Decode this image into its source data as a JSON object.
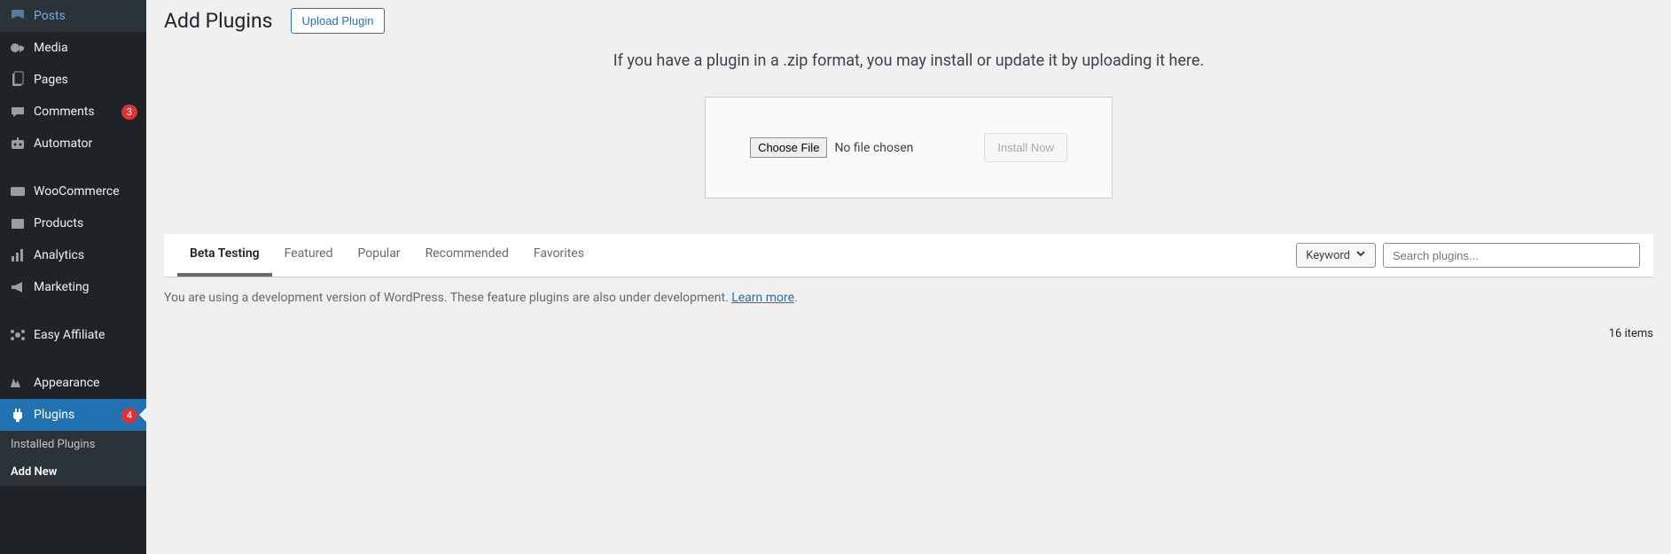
{
  "sidebar": {
    "items": [
      {
        "label": "Posts",
        "icon": "posts"
      },
      {
        "label": "Media",
        "icon": "media"
      },
      {
        "label": "Pages",
        "icon": "pages"
      },
      {
        "label": "Comments",
        "icon": "comments",
        "badge": "3"
      },
      {
        "label": "Automator",
        "icon": "automator"
      },
      {
        "label": "WooCommerce",
        "icon": "woo"
      },
      {
        "label": "Products",
        "icon": "products"
      },
      {
        "label": "Analytics",
        "icon": "analytics"
      },
      {
        "label": "Marketing",
        "icon": "marketing"
      },
      {
        "label": "Easy Affiliate",
        "icon": "affiliate"
      },
      {
        "label": "Appearance",
        "icon": "appearance"
      },
      {
        "label": "Plugins",
        "icon": "plugins",
        "badge": "4",
        "active": true
      }
    ],
    "submenu": [
      {
        "label": "Installed Plugins"
      },
      {
        "label": "Add New",
        "active": true
      }
    ]
  },
  "header": {
    "title": "Add Plugins",
    "upload_button": "Upload Plugin"
  },
  "upload": {
    "hint": "If you have a plugin in a .zip format, you may install or update it by uploading it here.",
    "choose_file": "Choose File",
    "no_file": "No file chosen",
    "install": "Install Now"
  },
  "tabs": [
    {
      "label": "Beta Testing",
      "active": true
    },
    {
      "label": "Featured"
    },
    {
      "label": "Popular"
    },
    {
      "label": "Recommended"
    },
    {
      "label": "Favorites"
    }
  ],
  "search": {
    "dropdown": "Keyword",
    "placeholder": "Search plugins..."
  },
  "notice": {
    "text": "You are using a development version of WordPress. These feature plugins are also under development. ",
    "link_text": "Learn more",
    "period": "."
  },
  "footer": {
    "items_count": "16 items"
  }
}
